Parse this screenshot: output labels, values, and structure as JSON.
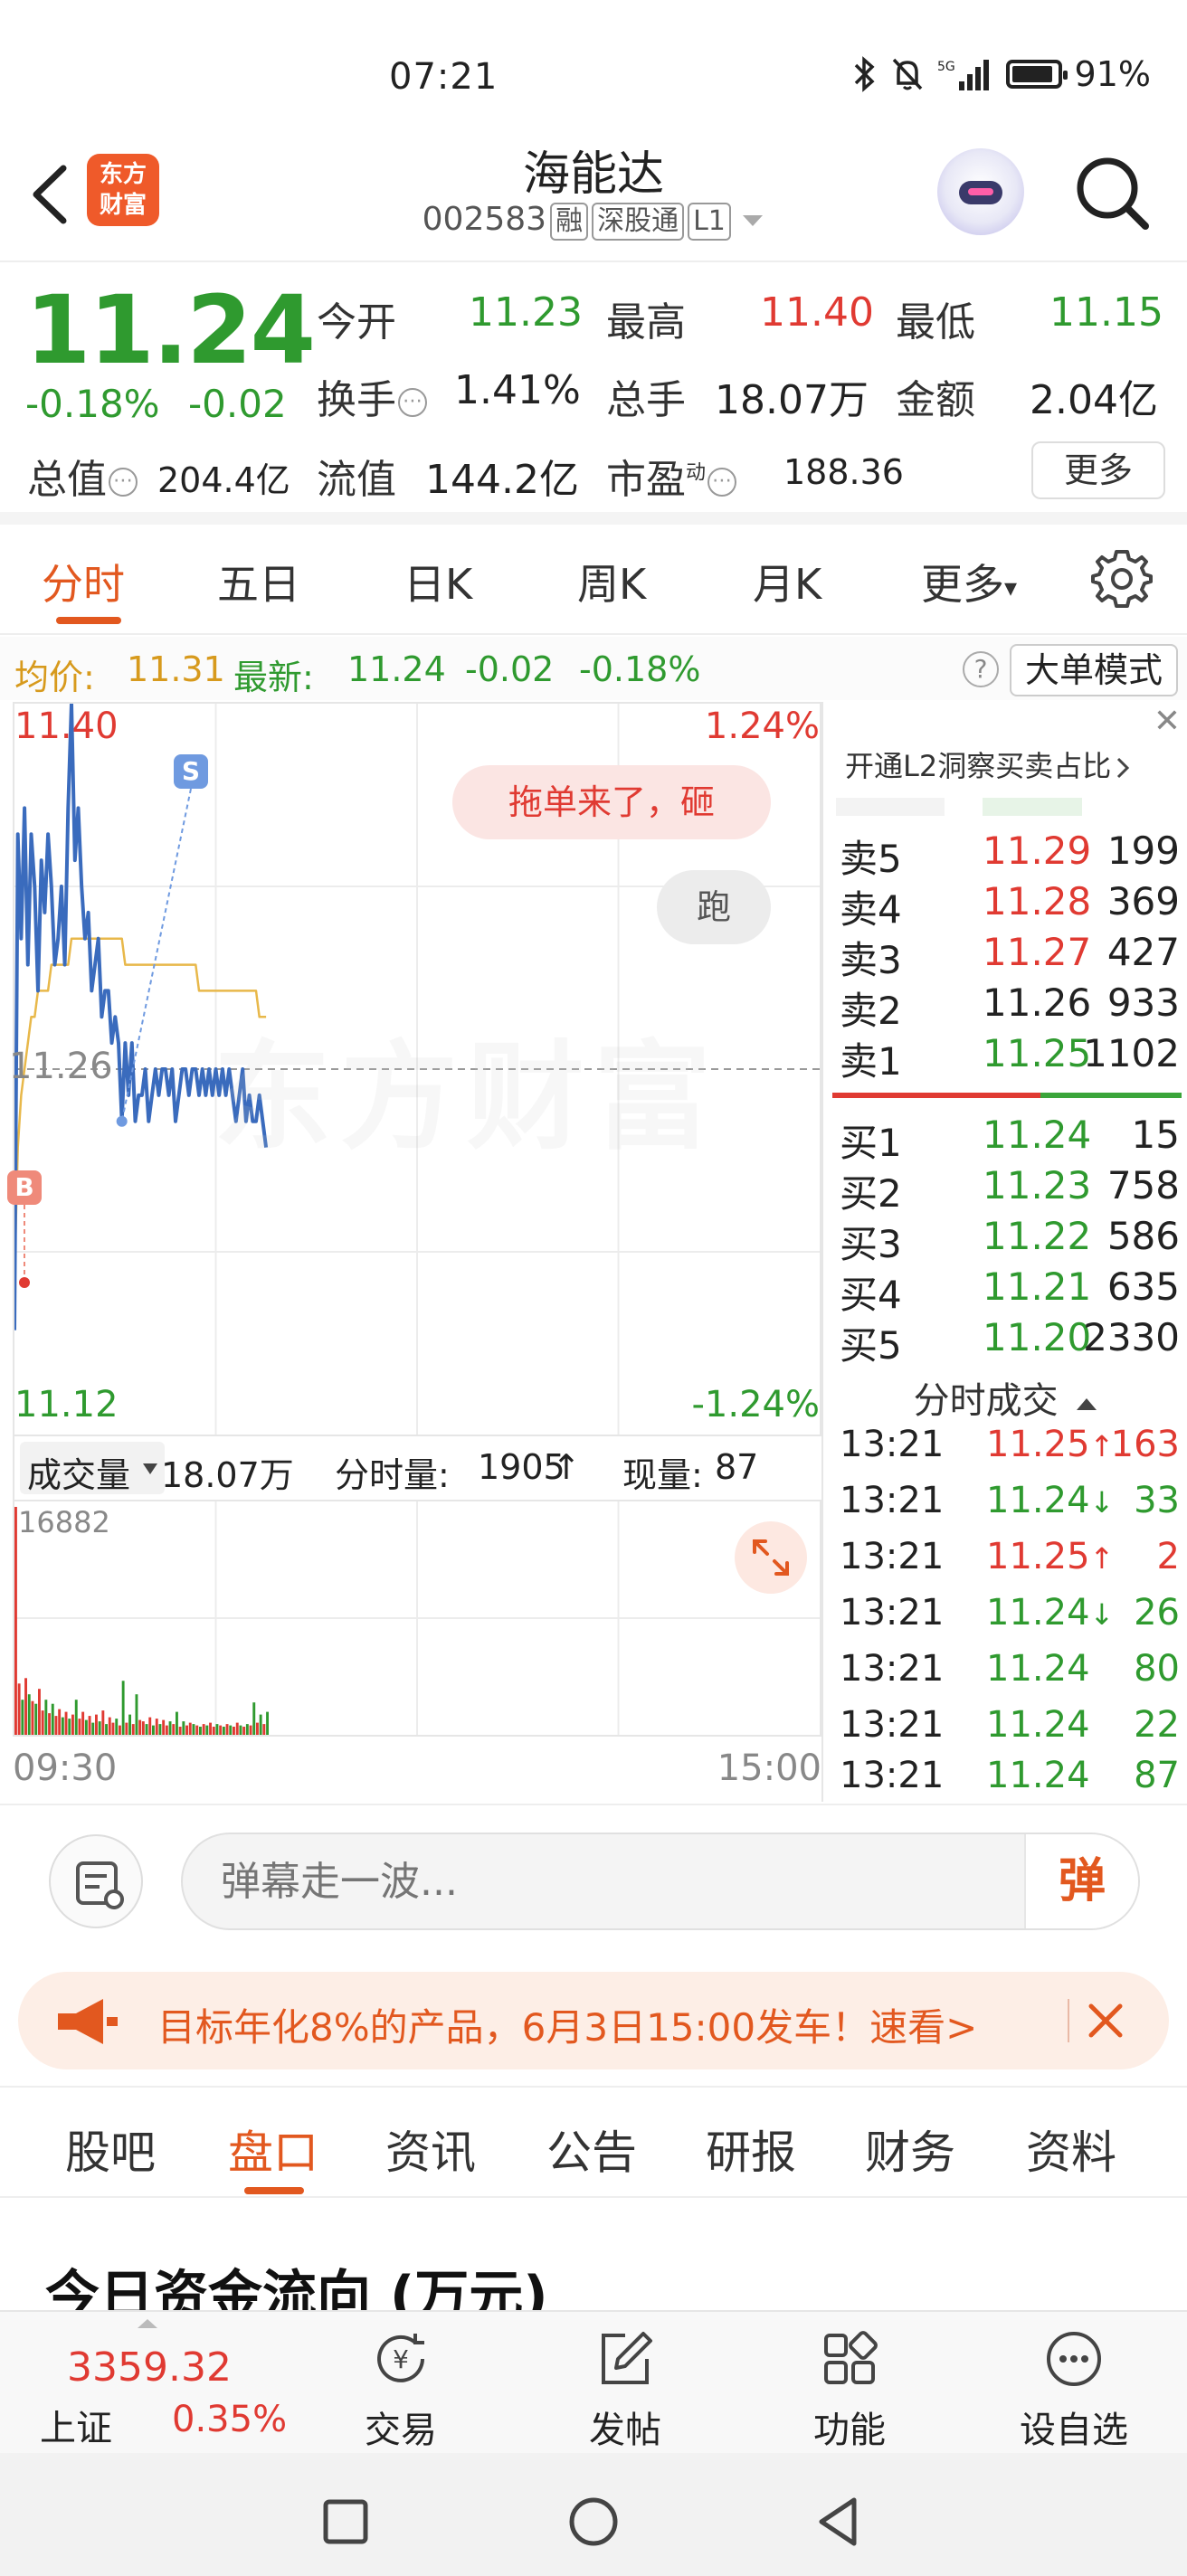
{
  "status_bar": {
    "time": "07:21",
    "battery": "91%",
    "battery_level": 0.91
  },
  "header": {
    "stock_name": "海能达",
    "stock_code": "002583",
    "tags": [
      "融",
      "深股通",
      "L1"
    ],
    "logo_text": [
      "东方",
      "财富"
    ]
  },
  "quote": {
    "price": "11.24",
    "change_pct": "-0.18%",
    "change_abs": "-0.02",
    "open_label": "今开",
    "open": "11.23",
    "high_label": "最高",
    "high": "11.40",
    "low_label": "最低",
    "low": "11.15",
    "turnover_label": "换手",
    "turnover": "1.41%",
    "volume_label": "总手",
    "volume": "18.07万",
    "amount_label": "金额",
    "amount": "2.04亿",
    "mktcap_label": "总值",
    "mktcap": "204.4亿",
    "float_label": "流值",
    "float_cap": "144.2亿",
    "pe_label": "市盈",
    "pe_sup": "动",
    "pe": "188.36",
    "more_label": "更多",
    "info_glyph": "⋯"
  },
  "chart_tabs": {
    "items": [
      "分时",
      "五日",
      "日K",
      "周K",
      "月K",
      "更多"
    ],
    "active": 0,
    "more_arrow": "▾"
  },
  "avg_bar": {
    "avg_label": "均价:",
    "avg_value": "11.31",
    "latest_label": "最新:",
    "latest_value": "11.24",
    "latest_change": "-0.02",
    "latest_pct": "-0.18%",
    "help": "?",
    "big_order_label": "大单模式"
  },
  "chart": {
    "y_top": "11.40",
    "y_mid": "11.26",
    "y_bottom": "11.12",
    "pct_top": "1.24%",
    "pct_bottom": "-1.24%",
    "watermark": "东方财富",
    "danmu_bubble": "拖单来了，砸",
    "run_bubble": "跑",
    "marker_sell": "S",
    "marker_buy": "B",
    "colors": {
      "price": "#3a6bbd",
      "avg": "#e8b84a",
      "up": "#e03a32",
      "down": "#2f9a2f"
    }
  },
  "chart_data": {
    "type": "line",
    "ylim": [
      11.12,
      11.4
    ],
    "x_start": "09:30",
    "x_end": "15:00",
    "series": [
      {
        "values": [
          11.16,
          11.35,
          11.31,
          11.36,
          11.3,
          11.35,
          11.33,
          11.29,
          11.34,
          11.32,
          11.35,
          11.33,
          11.3,
          11.31,
          11.33,
          11.3,
          11.36,
          11.4,
          11.34,
          11.36,
          11.33,
          11.31,
          11.32,
          11.29,
          11.3,
          11.31,
          11.28,
          11.29,
          11.29,
          11.27,
          11.28,
          11.27,
          11.24,
          11.27,
          11.25,
          11.27,
          11.24,
          11.25,
          11.25,
          11.26,
          11.24,
          11.25,
          11.26,
          11.25,
          11.26,
          11.26,
          11.25,
          11.26,
          11.24,
          11.25,
          11.26,
          11.26,
          11.25,
          11.26,
          11.26,
          11.25,
          11.26,
          11.25,
          11.26,
          11.25,
          11.26,
          11.25,
          11.26,
          11.25,
          11.26,
          11.25,
          11.24,
          11.25,
          11.26,
          11.24,
          11.25,
          11.24,
          11.24,
          11.25,
          11.24,
          11.23
        ]
      },
      {
        "values": [
          11.18,
          11.23,
          11.25,
          11.26,
          11.27,
          11.28,
          11.28,
          11.29,
          11.29,
          11.29,
          11.29,
          11.3,
          11.3,
          11.3,
          11.3,
          11.3,
          11.3,
          11.31,
          11.31,
          11.31,
          11.31,
          11.31,
          11.31,
          11.31,
          11.31,
          11.31,
          11.31,
          11.31,
          11.31,
          11.31,
          11.31,
          11.31,
          11.31,
          11.3,
          11.3,
          11.3,
          11.3,
          11.3,
          11.3,
          11.3,
          11.3,
          11.3,
          11.3,
          11.3,
          11.3,
          11.3,
          11.3,
          11.3,
          11.3,
          11.3,
          11.3,
          11.3,
          11.3,
          11.3,
          11.3,
          11.29,
          11.29,
          11.29,
          11.29,
          11.29,
          11.29,
          11.29,
          11.29,
          11.29,
          11.29,
          11.29,
          11.29,
          11.29,
          11.29,
          11.29,
          11.29,
          11.29,
          11.29,
          11.28,
          11.28,
          11.28
        ]
      }
    ]
  },
  "volume": {
    "select_label": "成交量",
    "total": "18.07万",
    "minute_label": "分时量:",
    "minute_value": "1905",
    "minute_arrow": "↑",
    "current_label": "现量:",
    "current_value": "87",
    "max_label": "16882",
    "time_start": "09:30",
    "time_end": "15:00",
    "max": 16882,
    "bars": [
      16882,
      3800,
      2600,
      4200,
      3000,
      2500,
      2300,
      3400,
      1800,
      2600,
      1600,
      2300,
      1400,
      1900,
      1300,
      1700,
      1200,
      1500,
      2600,
      1200,
      1700,
      1100,
      1400,
      900,
      1500,
      1000,
      1800,
      800,
      1300,
      900,
      1200,
      700,
      4000,
      900,
      1500,
      800,
      3000,
      1100,
      1000,
      800,
      1300,
      700,
      1200,
      800,
      1100,
      700,
      1000,
      800,
      1700,
      600,
      1000,
      700,
      900,
      800,
      700,
      600,
      800,
      700,
      900,
      600,
      800,
      700,
      600,
      800,
      700,
      600,
      900,
      700,
      600,
      800,
      700,
      2400,
      900,
      1500,
      800,
      1700
    ],
    "bar_colors": [
      "r",
      "r",
      "g",
      "r",
      "g",
      "r",
      "g",
      "r",
      "r",
      "g",
      "r",
      "g",
      "r",
      "r",
      "g",
      "r",
      "g",
      "r",
      "g",
      "r",
      "r",
      "g",
      "r",
      "g",
      "r",
      "g",
      "r",
      "g",
      "r",
      "r",
      "g",
      "r",
      "g",
      "r",
      "g",
      "r",
      "g",
      "r",
      "r",
      "g",
      "r",
      "g",
      "r",
      "g",
      "r",
      "r",
      "g",
      "r",
      "g",
      "r",
      "g",
      "r",
      "r",
      "g",
      "r",
      "g",
      "r",
      "g",
      "r",
      "r",
      "g",
      "r",
      "g",
      "r",
      "g",
      "r",
      "r",
      "g",
      "r",
      "g",
      "r",
      "g",
      "r",
      "g",
      "r",
      "g"
    ]
  },
  "order_book": {
    "l2_link": "开通L2洞察买卖占比",
    "close": "✕",
    "sells": [
      {
        "label": "卖5",
        "price": "11.29",
        "volume": "199",
        "color": "red"
      },
      {
        "label": "卖4",
        "price": "11.28",
        "volume": "369",
        "color": "red"
      },
      {
        "label": "卖3",
        "price": "11.27",
        "volume": "427",
        "color": "red"
      },
      {
        "label": "卖2",
        "price": "11.26",
        "volume": "933",
        "color": "black"
      },
      {
        "label": "卖1",
        "price": "11.25",
        "volume": "1102",
        "color": "green"
      }
    ],
    "buys": [
      {
        "label": "买1",
        "price": "11.24",
        "volume": "15",
        "color": "green"
      },
      {
        "label": "买2",
        "price": "11.23",
        "volume": "758",
        "color": "green"
      },
      {
        "label": "买3",
        "price": "11.22",
        "volume": "586",
        "color": "green"
      },
      {
        "label": "买4",
        "price": "11.21",
        "volume": "635",
        "color": "green"
      },
      {
        "label": "买5",
        "price": "11.20",
        "volume": "2330",
        "color": "green"
      }
    ],
    "trades_title": "分时成交",
    "trades": [
      {
        "time": "13:21",
        "price": "11.25",
        "dir": "↑",
        "volume": "163",
        "color": "red"
      },
      {
        "time": "13:21",
        "price": "11.24",
        "dir": "↓",
        "volume": "33",
        "color": "green"
      },
      {
        "time": "13:21",
        "price": "11.25",
        "dir": "↑",
        "volume": "2",
        "color": "red"
      },
      {
        "time": "13:21",
        "price": "11.24",
        "dir": "↓",
        "volume": "26",
        "color": "green"
      },
      {
        "time": "13:21",
        "price": "11.24",
        "dir": "",
        "volume": "80",
        "color": "green"
      },
      {
        "time": "13:21",
        "price": "11.24",
        "dir": "",
        "volume": "22",
        "color": "green"
      },
      {
        "time": "13:21",
        "price": "11.24",
        "dir": "",
        "volume": "87",
        "color": "green"
      }
    ]
  },
  "danmu": {
    "placeholder": "弹幕走一波...",
    "send_label": "弹"
  },
  "promo": {
    "text": "目标年化8%的产品，6月3日15:00发车！速看>"
  },
  "detail_tabs": {
    "items": [
      "股吧",
      "盘口",
      "资讯",
      "公告",
      "研报",
      "财务",
      "资料"
    ],
    "active": 1
  },
  "fund_flow": {
    "title": "今日资金流向 (万元)"
  },
  "bottom_nav": {
    "index_value": "3359.32",
    "index_name": "上证",
    "index_change": "0.35%",
    "items": [
      "交易",
      "发帖",
      "功能",
      "设自选"
    ]
  }
}
